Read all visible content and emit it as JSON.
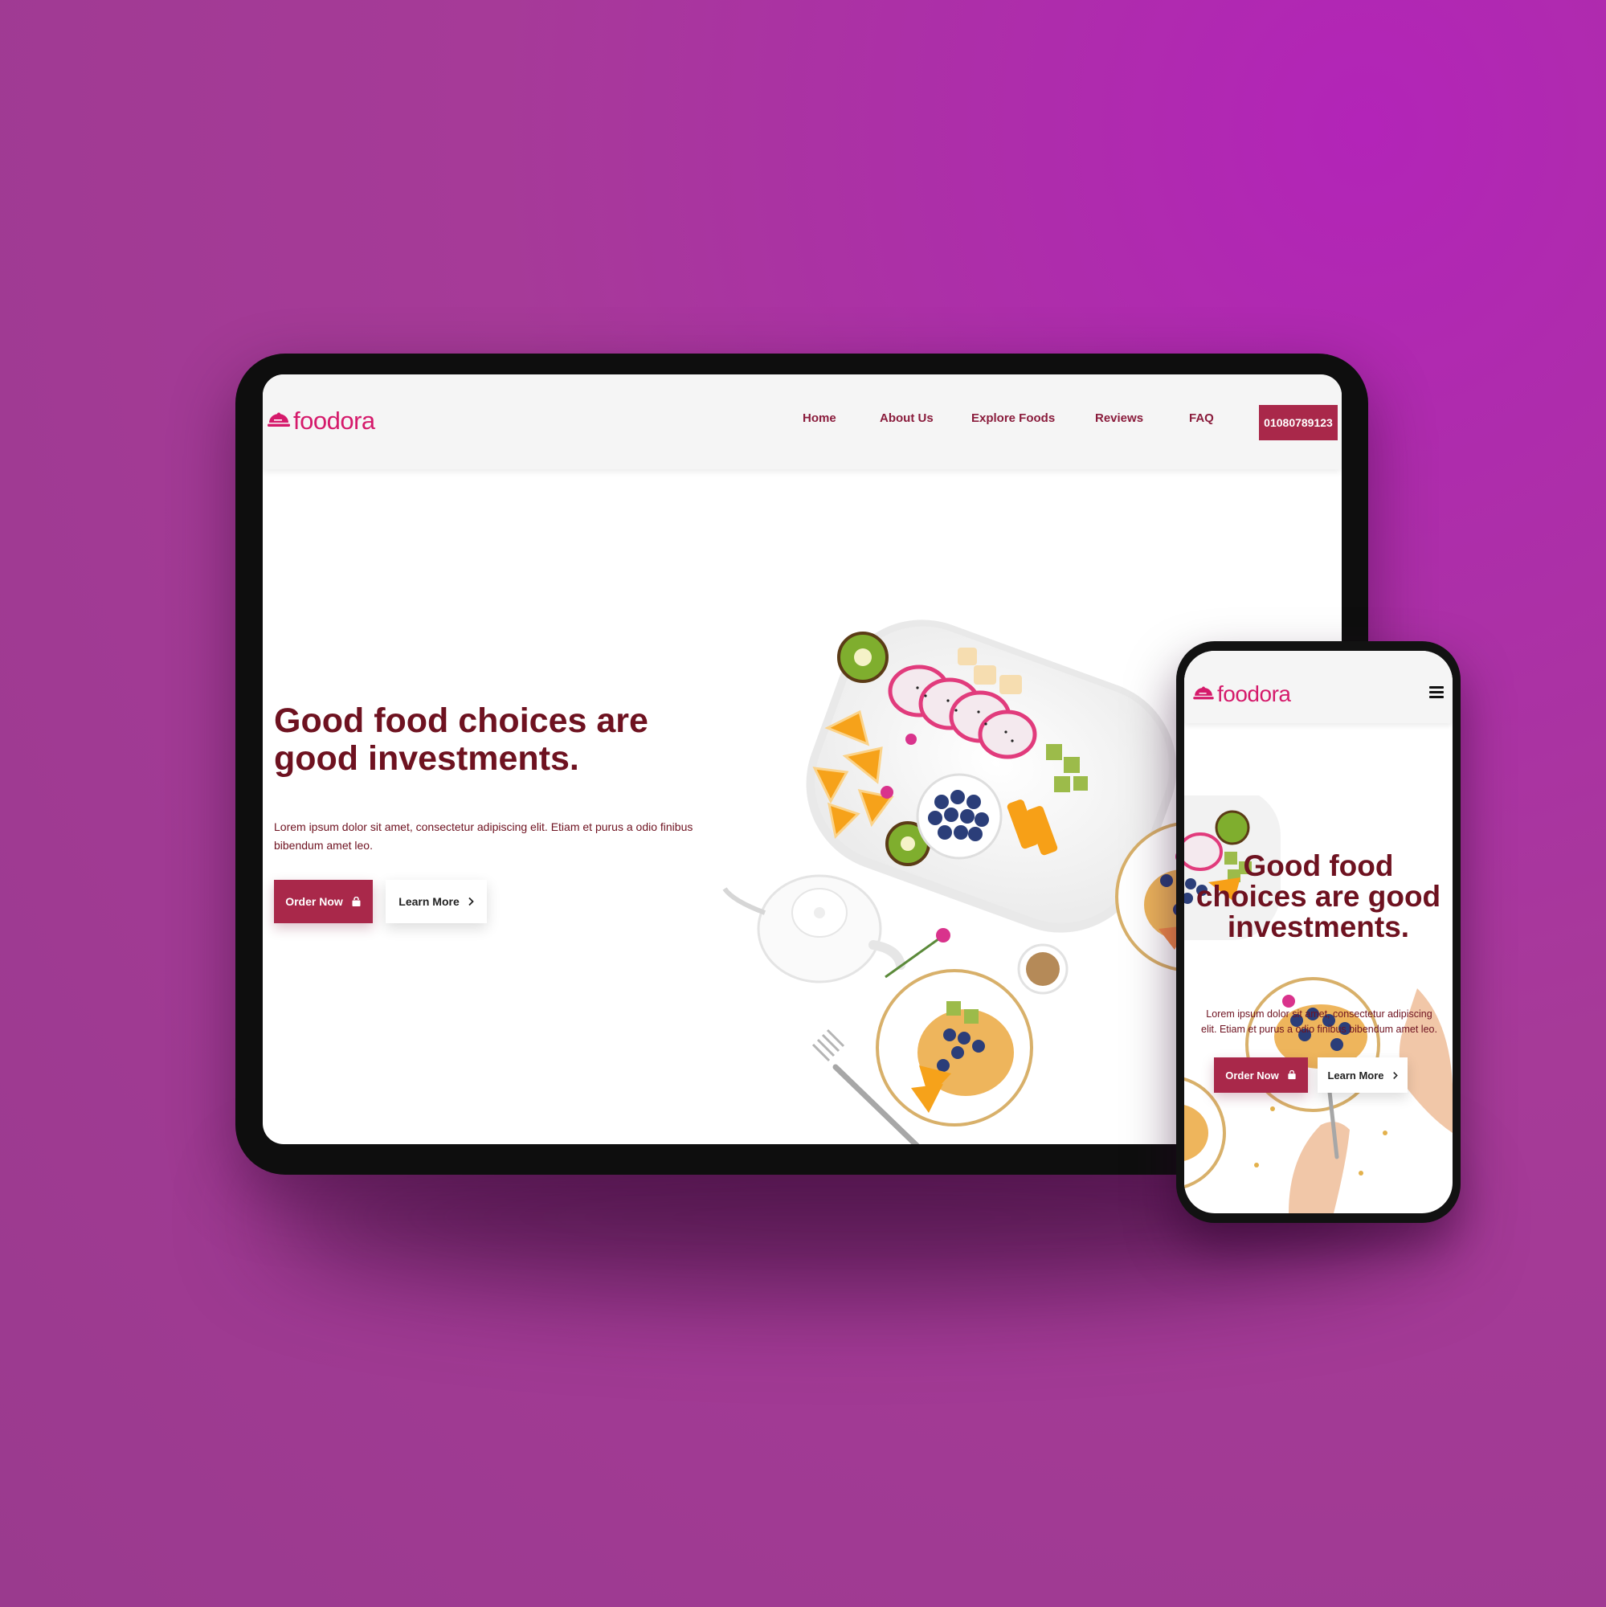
{
  "brand": {
    "name": "foodora",
    "color": "#d51a6b"
  },
  "accent": "#a9284a",
  "headline_color": "#6e1220",
  "tablet": {
    "nav": [
      {
        "label": "Home"
      },
      {
        "label": "About Us"
      },
      {
        "label": "Explore Foods"
      },
      {
        "label": "Reviews"
      },
      {
        "label": "FAQ"
      }
    ],
    "phone_number": "01080789123",
    "hero": {
      "title": "Good food choices are good investments.",
      "description": "Lorem ipsum dolor sit amet, consectetur adipiscing elit. Etiam et purus a odio finibus bibendum amet leo.",
      "order_label": "Order Now",
      "learn_label": "Learn More"
    }
  },
  "phone": {
    "hero": {
      "title": "Good food choices are good investments.",
      "description": "Lorem ipsum dolor sit amet, consectetur adipiscing elit. Etiam et purus a odio finibus bibendum amet leo.",
      "order_label": "Order Now",
      "learn_label": "Learn More"
    }
  },
  "icons": [
    "food-cloche-icon",
    "shopping-bag-icon",
    "chevron-right-icon",
    "hamburger-menu-icon"
  ]
}
